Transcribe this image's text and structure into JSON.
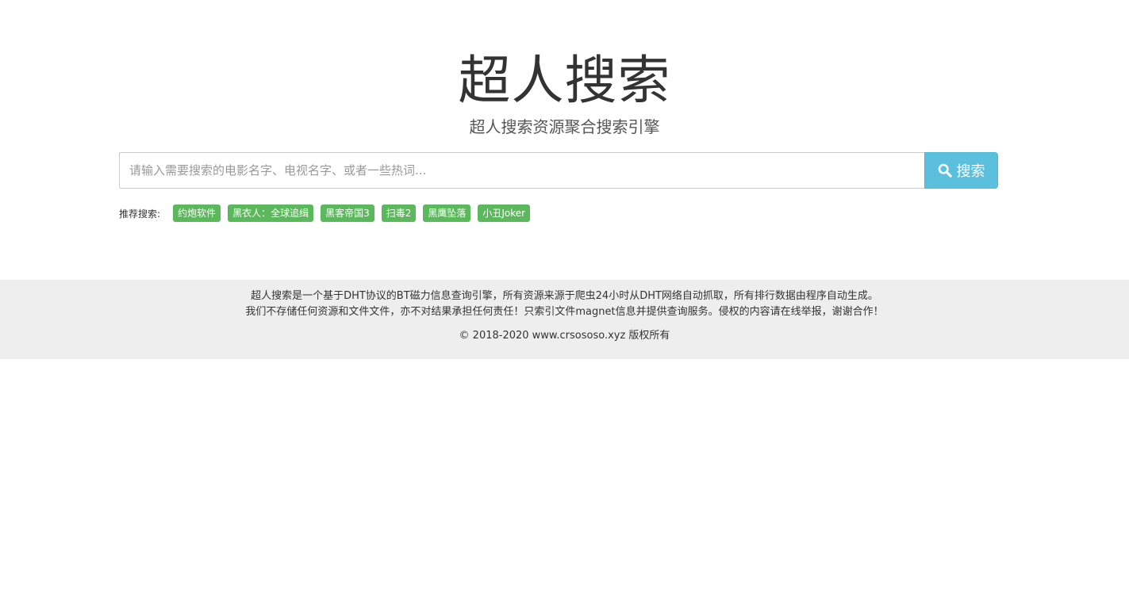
{
  "header": {
    "title": "超人搜索",
    "subtitle": "超人搜索资源聚合搜索引擎"
  },
  "search": {
    "placeholder": "请输入需要搜索的电影名字、电视名字、或者一些热词...",
    "value": "",
    "button_label": "搜索",
    "button_icon": "search-icon",
    "button_color": "#5bc0de"
  },
  "hot_searches": {
    "label": "推荐搜索:",
    "tag_color": "#5cb85c",
    "tags": [
      "约炮软件",
      "黑衣人：全球追缉",
      "黑客帝国3",
      "扫毒2",
      "黑鹰坠落",
      "小丑Joker"
    ]
  },
  "footer": {
    "line1": "超人搜索是一个基于DHT协议的BT磁力信息查询引擎，所有资源来源于爬虫24小时从DHT网络自动抓取，所有排行数据由程序自动生成。",
    "line2": "我们不存储任何资源和文件文件，亦不对结果承担任何责任！只索引文件magnet信息并提供查询服务。侵权的内容请在线举报，谢谢合作！",
    "copyright": "© 2018-2020  www.crsososo.xyz 版权所有",
    "background": "#eeeeee"
  }
}
